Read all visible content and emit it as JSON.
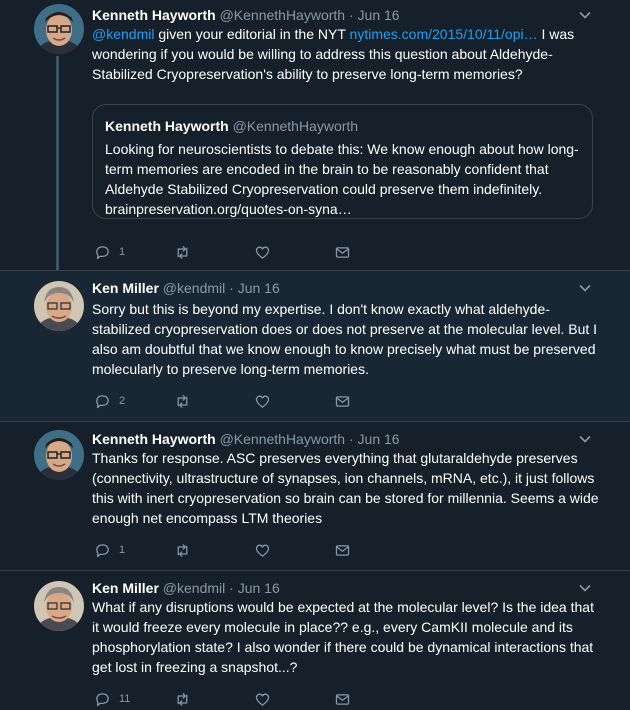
{
  "tweets": [
    {
      "name": "Kenneth Hayworth",
      "handle": "@KennethHayworth",
      "dot": "·",
      "time": "Jun 16",
      "mention": "@kendmil",
      "text_a": " given your editorial in the NYT ",
      "link": "nytimes.com/2015/10/11/opi…",
      "text_b": "  I was wondering if you would be willing to address this question about Aldehyde-Stabilized Cryopreservation's ability to preserve long-term memories?",
      "quote": {
        "name": "Kenneth Hayworth",
        "handle": "@KennethHayworth",
        "text": "Looking for neuroscientists to debate this: We know enough about how long-term memories are encoded in the brain to be reasonably confident that Aldehyde Stabilized Cryopreservation could preserve them indefinitely. brainpreservation.org/quotes-on-syna…"
      },
      "replies": "1"
    },
    {
      "name": "Ken Miller",
      "handle": "@kendmil",
      "dot": "·",
      "time": "Jun 16",
      "text": "Sorry but this is beyond my expertise. I don't know exactly what aldehyde-stabilized cryopreservation does or does not preserve at the molecular level. But I also am doubtful that we know enough to know precisely what must be preserved molecularly to preserve long-term memories.",
      "replies": "2"
    },
    {
      "name": "Kenneth Hayworth",
      "handle": "@KennethHayworth",
      "dot": "·",
      "time": "Jun 16",
      "text": "Thanks for response. ASC preserves everything that glutaraldehyde preserves (connectivity, ultrastructure of synapses, ion channels, mRNA, etc.), it just follows this with inert cryopreservation so brain can be stored for millennia. Seems a wide enough net encompass LTM theories",
      "replies": "1"
    },
    {
      "name": "Ken Miller",
      "handle": "@kendmil",
      "dot": "·",
      "time": "Jun 16",
      "text": "What if any disruptions would be expected at the molecular level? Is the idea that it would freeze every molecule in place?? e.g., every CamKII molecule and its phosphorylation state? I also wonder if there could be dynamical interactions that get lost in freezing a snapshot...?",
      "replies": "11"
    }
  ],
  "icons": {
    "reply": "reply-icon",
    "retweet": "retweet-icon",
    "like": "heart-icon",
    "dm": "envelope-icon",
    "more": "chevron-down-icon"
  },
  "colors": {
    "background": "#15202b",
    "highlight": "#192734",
    "link": "#1da1f2",
    "secondary": "#8899a6",
    "border": "#38444d"
  }
}
